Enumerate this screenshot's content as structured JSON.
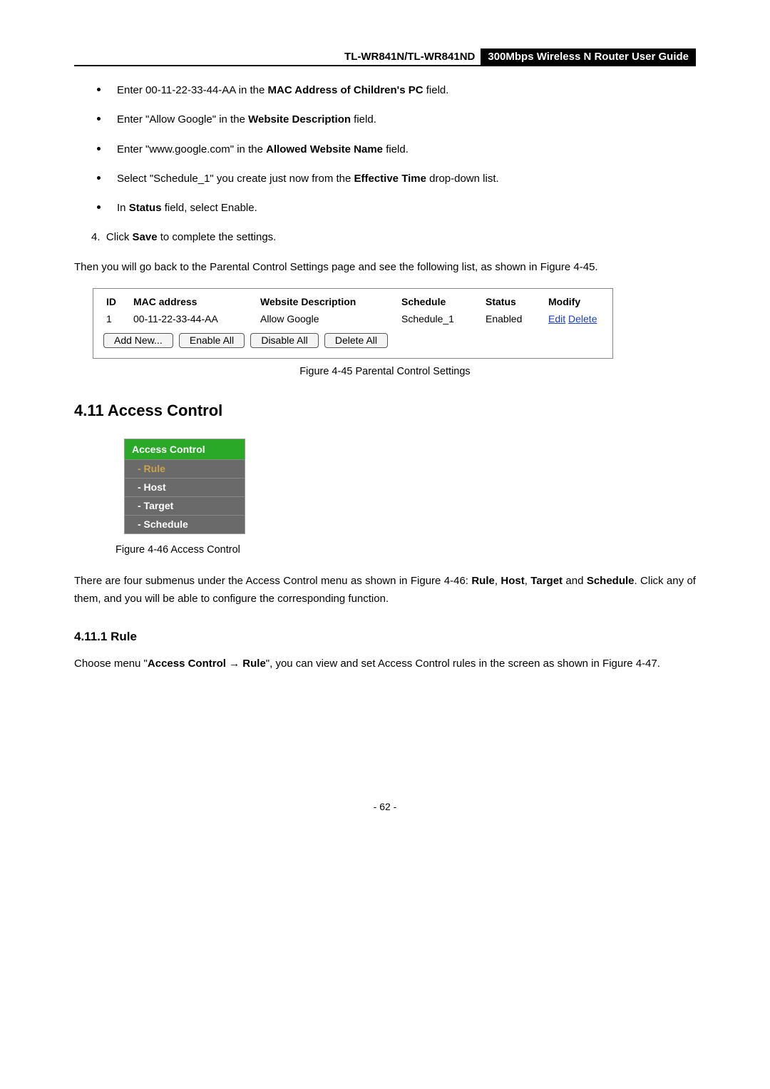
{
  "header": {
    "model": "TL-WR841N/TL-WR841ND",
    "guide": "300Mbps Wireless N Router User Guide"
  },
  "bullets": [
    {
      "pre": "Enter 00-11-22-33-44-AA in the ",
      "bold": "MAC Address of Children's PC",
      "post": " field."
    },
    {
      "pre": "Enter \"Allow Google\" in the ",
      "bold": "Website Description",
      "post": " field."
    },
    {
      "pre": "Enter \"www.google.com\" in the ",
      "bold": "Allowed Website Name",
      "post": " field."
    },
    {
      "pre": "Select \"Schedule_1\" you create just now from the ",
      "bold": "Effective Time",
      "post": " drop-down list."
    },
    {
      "pre": "In ",
      "bold": "Status",
      "post": " field, select Enable."
    }
  ],
  "step4": {
    "num": "4.",
    "pre": "Click ",
    "bold": "Save",
    "post": " to complete the settings."
  },
  "para1": "Then you will go back to the Parental Control Settings page and see the following list, as shown in Figure 4-45.",
  "table": {
    "headers": {
      "id": "ID",
      "mac": "MAC address",
      "desc": "Website Description",
      "sched": "Schedule",
      "status": "Status",
      "modify": "Modify"
    },
    "row": {
      "id": "1",
      "mac": "00-11-22-33-44-AA",
      "desc": "Allow Google",
      "sched": "Schedule_1",
      "status": "Enabled",
      "edit": "Edit",
      "delete": "Delete"
    },
    "buttons": {
      "addnew": "Add New...",
      "enableall": "Enable All",
      "disableall": "Disable All",
      "deleteall": "Delete All"
    }
  },
  "fig45": "Figure 4-45    Parental Control Settings",
  "section": {
    "num": "4.11",
    "title": "Access Control"
  },
  "menu": {
    "head": "Access Control",
    "items": [
      "- Rule",
      "- Host",
      "- Target",
      "- Schedule"
    ]
  },
  "fig46": "Figure 4-46 Access Control",
  "para2a": "There are four submenus under the Access Control menu as shown in Figure 4-46: ",
  "para2b": "Rule",
  "para2c": ", ",
  "para2d": "Host",
  "para2e": ", ",
  "para2f": "Target",
  "para2g": " and ",
  "para2h": "Schedule",
  "para2i": ". Click any of them, and you will be able to configure the corresponding function.",
  "subsection": {
    "num": "4.11.1",
    "title": "Rule"
  },
  "para3a": "Choose menu \"",
  "para3b": "Access Control",
  "para3c": " → ",
  "para3d": "Rule",
  "para3e": "\", you can view and set Access Control rules in the screen as shown in Figure 4-47.",
  "pagenum": "- 62 -"
}
